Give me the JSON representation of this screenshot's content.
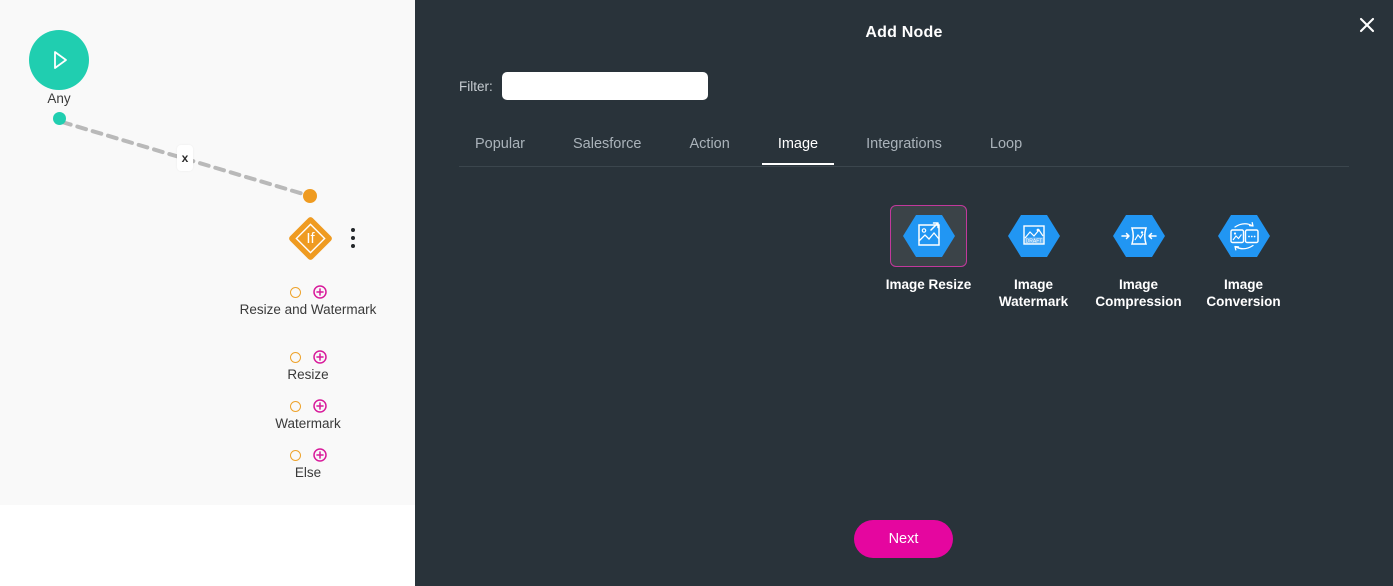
{
  "canvas": {
    "start_node": {
      "label": "Any",
      "icon": "play-icon",
      "color": "#20ceb0"
    },
    "edge": {
      "delete_label": "x",
      "style": "dashed",
      "color": "#b9b9b9"
    },
    "decision_node": {
      "label": "If",
      "color": "#ef9b21",
      "menu_icon": "kebab-menu-icon"
    },
    "branches": [
      {
        "label": "Resize and Watermark",
        "ring_icon": "branch-port-icon",
        "add_icon": "plus-circle-icon"
      },
      {
        "label": "Resize",
        "ring_icon": "branch-port-icon",
        "add_icon": "plus-circle-icon"
      },
      {
        "label": "Watermark",
        "ring_icon": "branch-port-icon",
        "add_icon": "plus-circle-icon"
      },
      {
        "label": "Else",
        "ring_icon": "branch-port-icon",
        "add_icon": "plus-circle-icon"
      }
    ],
    "colors": {
      "background": "#f9f9f9",
      "port_ring": "#eea32c",
      "add": "#d81b9b"
    }
  },
  "panel": {
    "title": "Add Node",
    "close_icon": "close-icon",
    "background": "#29333a",
    "filter": {
      "label": "Filter:",
      "value": "",
      "placeholder": ""
    },
    "tabs": [
      {
        "label": "Popular",
        "active": false
      },
      {
        "label": "Salesforce",
        "active": false
      },
      {
        "label": "Action",
        "active": false
      },
      {
        "label": "Image",
        "active": true
      },
      {
        "label": "Integrations",
        "active": false
      },
      {
        "label": "Loop",
        "active": false
      }
    ],
    "cards": [
      {
        "label": "Image Resize",
        "icon": "image-resize-icon",
        "selected": true
      },
      {
        "label": "Image Watermark",
        "icon": "image-watermark-icon",
        "selected": false
      },
      {
        "label": "Image Compression",
        "icon": "image-compression-icon",
        "selected": false
      },
      {
        "label": "Image Conversion",
        "icon": "image-conversion-icon",
        "selected": false
      }
    ],
    "next_button": {
      "label": "Next",
      "color": "#e5069f"
    },
    "accent": {
      "selected_border": "#c2399c",
      "icon_blue": "#2196f3"
    }
  }
}
